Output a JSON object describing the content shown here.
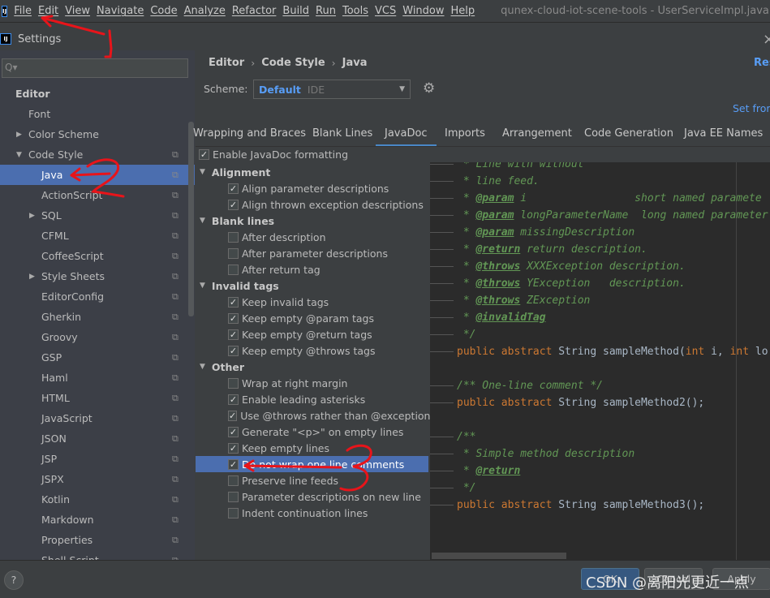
{
  "menubar": {
    "items": [
      "File",
      "Edit",
      "View",
      "Navigate",
      "Code",
      "Analyze",
      "Refactor",
      "Build",
      "Run",
      "Tools",
      "VCS",
      "Window",
      "Help"
    ],
    "window_title": "qunex-cloud-iot-scene-tools - UserServiceImpl.java [q"
  },
  "dialog": {
    "title": "Settings",
    "close": "×"
  },
  "search": {
    "placeholder": "Q▾"
  },
  "tree": [
    {
      "label": "Editor",
      "level": 0,
      "bold": true
    },
    {
      "label": "Font",
      "level": 1
    },
    {
      "label": "Color Scheme",
      "level": 1,
      "arrow": "▶"
    },
    {
      "label": "Code Style",
      "level": 1,
      "arrow": "▼",
      "copy": true
    },
    {
      "label": "Java",
      "level": 2,
      "copy": true,
      "selected": true
    },
    {
      "label": "ActionScript",
      "level": 2,
      "copy": true
    },
    {
      "label": "SQL",
      "level": 2,
      "copy": true,
      "arrow": "▶"
    },
    {
      "label": "CFML",
      "level": 2,
      "copy": true
    },
    {
      "label": "CoffeeScript",
      "level": 2,
      "copy": true
    },
    {
      "label": "Style Sheets",
      "level": 2,
      "copy": true,
      "arrow": "▶"
    },
    {
      "label": "EditorConfig",
      "level": 2,
      "copy": true
    },
    {
      "label": "Gherkin",
      "level": 2,
      "copy": true
    },
    {
      "label": "Groovy",
      "level": 2,
      "copy": true
    },
    {
      "label": "GSP",
      "level": 2,
      "copy": true
    },
    {
      "label": "Haml",
      "level": 2,
      "copy": true
    },
    {
      "label": "HTML",
      "level": 2,
      "copy": true
    },
    {
      "label": "JavaScript",
      "level": 2,
      "copy": true
    },
    {
      "label": "JSON",
      "level": 2,
      "copy": true
    },
    {
      "label": "JSP",
      "level": 2,
      "copy": true
    },
    {
      "label": "JSPX",
      "level": 2,
      "copy": true
    },
    {
      "label": "Kotlin",
      "level": 2,
      "copy": true
    },
    {
      "label": "Markdown",
      "level": 2,
      "copy": true
    },
    {
      "label": "Properties",
      "level": 2,
      "copy": true
    },
    {
      "label": "Shell Script",
      "level": 2,
      "copy": true
    }
  ],
  "breadcrumb": [
    "Editor",
    "Code Style",
    "Java"
  ],
  "reset_link": "Res",
  "scheme": {
    "label": "Scheme:",
    "value": "Default",
    "sub": "IDE"
  },
  "set_from": "Set from",
  "tabs": [
    {
      "label": "Wrapping and Braces"
    },
    {
      "label": "Blank Lines"
    },
    {
      "label": "JavaDoc",
      "active": true
    },
    {
      "label": "Imports"
    },
    {
      "label": "Arrangement"
    },
    {
      "label": "Code Generation"
    },
    {
      "label": "Java EE Names"
    }
  ],
  "enable_javadoc": {
    "label": "Enable JavaDoc formatting",
    "checked": true
  },
  "options": [
    {
      "group": "Alignment"
    },
    {
      "label": "Align parameter descriptions",
      "checked": true
    },
    {
      "label": "Align thrown exception descriptions",
      "checked": true
    },
    {
      "group": "Blank lines"
    },
    {
      "label": "After description",
      "checked": false
    },
    {
      "label": "After parameter descriptions",
      "checked": false
    },
    {
      "label": "After return tag",
      "checked": false
    },
    {
      "group": "Invalid tags"
    },
    {
      "label": "Keep invalid tags",
      "checked": true
    },
    {
      "label": "Keep empty @param tags",
      "checked": true
    },
    {
      "label": "Keep empty @return tags",
      "checked": true
    },
    {
      "label": "Keep empty @throws tags",
      "checked": true
    },
    {
      "group": "Other"
    },
    {
      "label": "Wrap at right margin",
      "checked": false
    },
    {
      "label": "Enable leading asterisks",
      "checked": true
    },
    {
      "label": "Use @throws rather than @exception",
      "checked": true
    },
    {
      "label": "Generate \"<p>\" on empty lines",
      "checked": true
    },
    {
      "label": "Keep empty lines",
      "checked": true
    },
    {
      "label": "Do not wrap one line comments",
      "checked": true,
      "selected": true
    },
    {
      "label": "Preserve line feeds",
      "checked": false
    },
    {
      "label": "Parameter descriptions on new line",
      "checked": false
    },
    {
      "label": "Indent continuation lines",
      "checked": false
    }
  ],
  "code_lines": [
    [
      [
        " * Line with without",
        "c"
      ]
    ],
    [
      [
        " * line feed.",
        "c"
      ]
    ],
    [
      [
        " * ",
        "c"
      ],
      [
        "@param",
        "tg"
      ],
      [
        " i                 short named paramete",
        "c"
      ]
    ],
    [
      [
        " * ",
        "c"
      ],
      [
        "@param",
        "tg"
      ],
      [
        " longParameterName  long named parameter",
        "c"
      ]
    ],
    [
      [
        " * ",
        "c"
      ],
      [
        "@param",
        "tg"
      ],
      [
        " missingDescription",
        "c"
      ]
    ],
    [
      [
        " * ",
        "c"
      ],
      [
        "@return",
        "tg"
      ],
      [
        " return description.",
        "c"
      ]
    ],
    [
      [
        " * ",
        "c"
      ],
      [
        "@throws",
        "tg"
      ],
      [
        " XXXException description.",
        "c"
      ]
    ],
    [
      [
        " * ",
        "c"
      ],
      [
        "@throws",
        "tg"
      ],
      [
        " YException   description.",
        "c"
      ]
    ],
    [
      [
        " * ",
        "c"
      ],
      [
        "@throws",
        "tg"
      ],
      [
        " ZException",
        "c"
      ]
    ],
    [
      [
        " * ",
        "c"
      ],
      [
        "@invalidTag",
        "tg"
      ]
    ],
    [
      [
        " */",
        "c"
      ]
    ],
    [
      [
        "public abstract ",
        "k"
      ],
      [
        "String sampleMethod(",
        "t"
      ],
      [
        "int ",
        "k"
      ],
      [
        "i, ",
        "t"
      ],
      [
        "int ",
        "k"
      ],
      [
        "lo",
        "t"
      ]
    ],
    [],
    [
      [
        "/** One-line comment */",
        "c"
      ]
    ],
    [
      [
        "public abstract ",
        "k"
      ],
      [
        "String sampleMethod2();",
        "t"
      ]
    ],
    [],
    [
      [
        "/**",
        "c"
      ]
    ],
    [
      [
        " * Simple method description",
        "c"
      ]
    ],
    [
      [
        " * ",
        "c"
      ],
      [
        "@return",
        "tg"
      ]
    ],
    [
      [
        " */",
        "c"
      ]
    ],
    [
      [
        "public abstract ",
        "k"
      ],
      [
        "String sampleMethod3();",
        "t"
      ]
    ]
  ],
  "footer": {
    "help": "?",
    "ok": "OK",
    "cancel": "Cancel",
    "apply": "Apply",
    "watermark": "CSDN @离阳光更近一点"
  },
  "annotations": [
    "1",
    "2",
    "3"
  ]
}
